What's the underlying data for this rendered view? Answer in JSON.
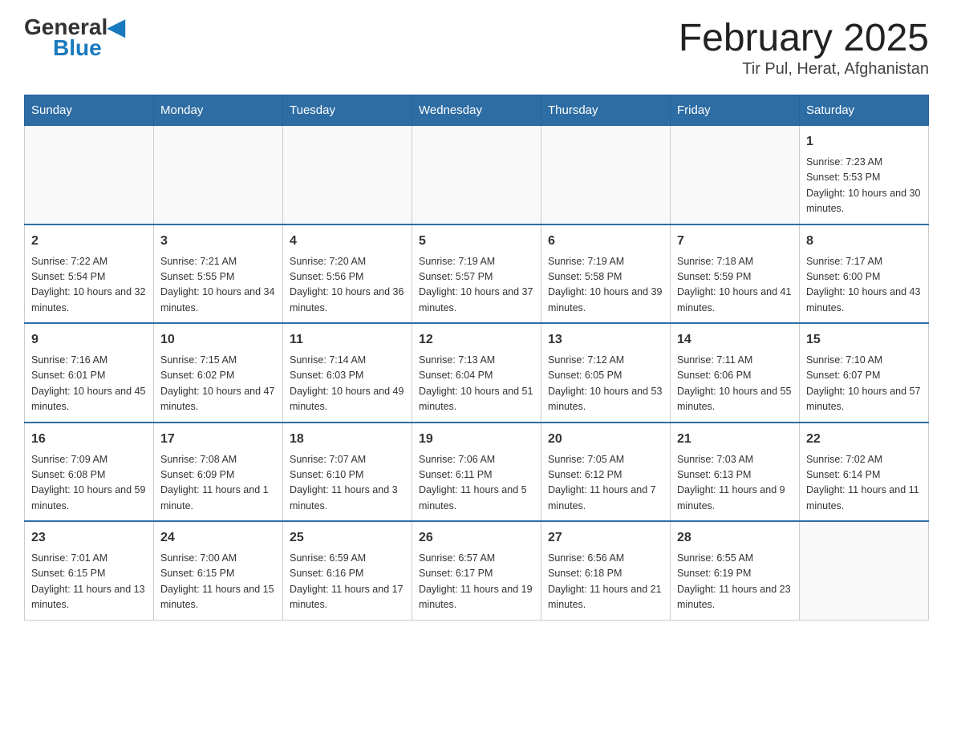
{
  "header": {
    "logo_general": "General",
    "logo_blue": "Blue",
    "title": "February 2025",
    "subtitle": "Tir Pul, Herat, Afghanistan"
  },
  "days_of_week": [
    "Sunday",
    "Monday",
    "Tuesday",
    "Wednesday",
    "Thursday",
    "Friday",
    "Saturday"
  ],
  "weeks": [
    [
      {
        "day": "",
        "info": ""
      },
      {
        "day": "",
        "info": ""
      },
      {
        "day": "",
        "info": ""
      },
      {
        "day": "",
        "info": ""
      },
      {
        "day": "",
        "info": ""
      },
      {
        "day": "",
        "info": ""
      },
      {
        "day": "1",
        "info": "Sunrise: 7:23 AM\nSunset: 5:53 PM\nDaylight: 10 hours and 30 minutes."
      }
    ],
    [
      {
        "day": "2",
        "info": "Sunrise: 7:22 AM\nSunset: 5:54 PM\nDaylight: 10 hours and 32 minutes."
      },
      {
        "day": "3",
        "info": "Sunrise: 7:21 AM\nSunset: 5:55 PM\nDaylight: 10 hours and 34 minutes."
      },
      {
        "day": "4",
        "info": "Sunrise: 7:20 AM\nSunset: 5:56 PM\nDaylight: 10 hours and 36 minutes."
      },
      {
        "day": "5",
        "info": "Sunrise: 7:19 AM\nSunset: 5:57 PM\nDaylight: 10 hours and 37 minutes."
      },
      {
        "day": "6",
        "info": "Sunrise: 7:19 AM\nSunset: 5:58 PM\nDaylight: 10 hours and 39 minutes."
      },
      {
        "day": "7",
        "info": "Sunrise: 7:18 AM\nSunset: 5:59 PM\nDaylight: 10 hours and 41 minutes."
      },
      {
        "day": "8",
        "info": "Sunrise: 7:17 AM\nSunset: 6:00 PM\nDaylight: 10 hours and 43 minutes."
      }
    ],
    [
      {
        "day": "9",
        "info": "Sunrise: 7:16 AM\nSunset: 6:01 PM\nDaylight: 10 hours and 45 minutes."
      },
      {
        "day": "10",
        "info": "Sunrise: 7:15 AM\nSunset: 6:02 PM\nDaylight: 10 hours and 47 minutes."
      },
      {
        "day": "11",
        "info": "Sunrise: 7:14 AM\nSunset: 6:03 PM\nDaylight: 10 hours and 49 minutes."
      },
      {
        "day": "12",
        "info": "Sunrise: 7:13 AM\nSunset: 6:04 PM\nDaylight: 10 hours and 51 minutes."
      },
      {
        "day": "13",
        "info": "Sunrise: 7:12 AM\nSunset: 6:05 PM\nDaylight: 10 hours and 53 minutes."
      },
      {
        "day": "14",
        "info": "Sunrise: 7:11 AM\nSunset: 6:06 PM\nDaylight: 10 hours and 55 minutes."
      },
      {
        "day": "15",
        "info": "Sunrise: 7:10 AM\nSunset: 6:07 PM\nDaylight: 10 hours and 57 minutes."
      }
    ],
    [
      {
        "day": "16",
        "info": "Sunrise: 7:09 AM\nSunset: 6:08 PM\nDaylight: 10 hours and 59 minutes."
      },
      {
        "day": "17",
        "info": "Sunrise: 7:08 AM\nSunset: 6:09 PM\nDaylight: 11 hours and 1 minute."
      },
      {
        "day": "18",
        "info": "Sunrise: 7:07 AM\nSunset: 6:10 PM\nDaylight: 11 hours and 3 minutes."
      },
      {
        "day": "19",
        "info": "Sunrise: 7:06 AM\nSunset: 6:11 PM\nDaylight: 11 hours and 5 minutes."
      },
      {
        "day": "20",
        "info": "Sunrise: 7:05 AM\nSunset: 6:12 PM\nDaylight: 11 hours and 7 minutes."
      },
      {
        "day": "21",
        "info": "Sunrise: 7:03 AM\nSunset: 6:13 PM\nDaylight: 11 hours and 9 minutes."
      },
      {
        "day": "22",
        "info": "Sunrise: 7:02 AM\nSunset: 6:14 PM\nDaylight: 11 hours and 11 minutes."
      }
    ],
    [
      {
        "day": "23",
        "info": "Sunrise: 7:01 AM\nSunset: 6:15 PM\nDaylight: 11 hours and 13 minutes."
      },
      {
        "day": "24",
        "info": "Sunrise: 7:00 AM\nSunset: 6:15 PM\nDaylight: 11 hours and 15 minutes."
      },
      {
        "day": "25",
        "info": "Sunrise: 6:59 AM\nSunset: 6:16 PM\nDaylight: 11 hours and 17 minutes."
      },
      {
        "day": "26",
        "info": "Sunrise: 6:57 AM\nSunset: 6:17 PM\nDaylight: 11 hours and 19 minutes."
      },
      {
        "day": "27",
        "info": "Sunrise: 6:56 AM\nSunset: 6:18 PM\nDaylight: 11 hours and 21 minutes."
      },
      {
        "day": "28",
        "info": "Sunrise: 6:55 AM\nSunset: 6:19 PM\nDaylight: 11 hours and 23 minutes."
      },
      {
        "day": "",
        "info": ""
      }
    ]
  ]
}
